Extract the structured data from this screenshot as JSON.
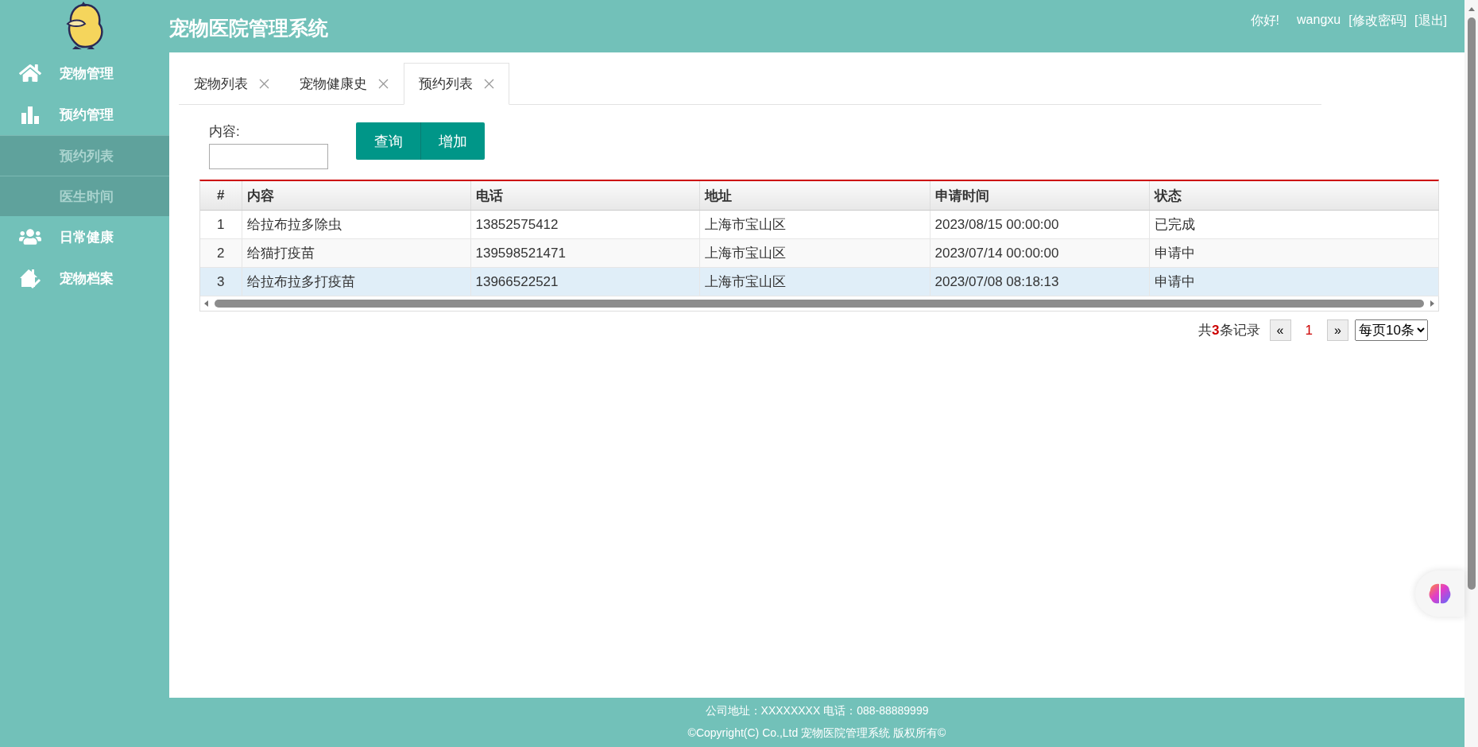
{
  "header": {
    "title": "宠物医院管理系统",
    "greeting": "你好!",
    "username": "wangxu",
    "links": [
      "[修改密码]",
      "[退出]"
    ]
  },
  "sidebar": {
    "items": [
      {
        "label": "宠物管理"
      },
      {
        "label": "预约管理",
        "children": [
          {
            "label": "预约列表"
          },
          {
            "label": "医生时间"
          }
        ]
      },
      {
        "label": "日常健康"
      },
      {
        "label": "宠物档案"
      }
    ]
  },
  "tabs": [
    {
      "label": "宠物列表",
      "selected": false
    },
    {
      "label": "宠物健康史",
      "selected": false
    },
    {
      "label": "预约列表",
      "selected": true
    }
  ],
  "search": {
    "label": "内容:"
  },
  "buttons": [
    "查询",
    "增加"
  ],
  "table": {
    "columns": [
      "#",
      "内容",
      "电话",
      "地址",
      "申请时间",
      "状态"
    ],
    "rows": [
      {
        "cells": [
          "1",
          "给拉布拉多除虫",
          "13852575412",
          "上海市宝山区",
          "2023/08/15 00:00:00",
          "已完成"
        ],
        "selected": false
      },
      {
        "cells": [
          "2",
          "给猫打疫苗",
          "139598521471",
          "上海市宝山区",
          "2023/07/14 00:00:00",
          "申请中"
        ],
        "selected": false
      },
      {
        "cells": [
          "3",
          "给拉布拉多打疫苗",
          "13966522521",
          "上海市宝山区",
          "2023/07/08 08:18:13",
          "申请中"
        ],
        "selected": true
      }
    ]
  },
  "pagination": {
    "summary": "共**3**条记录",
    "prev": "«",
    "pages": [
      {
        "label": "1",
        "selected": true
      }
    ],
    "next": "»",
    "page_size": "每页10条"
  },
  "footer": [
    "公司地址：XXXXXXXX 电话：088-88889999",
    "©Copyright(C) Co.,Ltd 宠物医院管理系统 版权所有©"
  ]
}
